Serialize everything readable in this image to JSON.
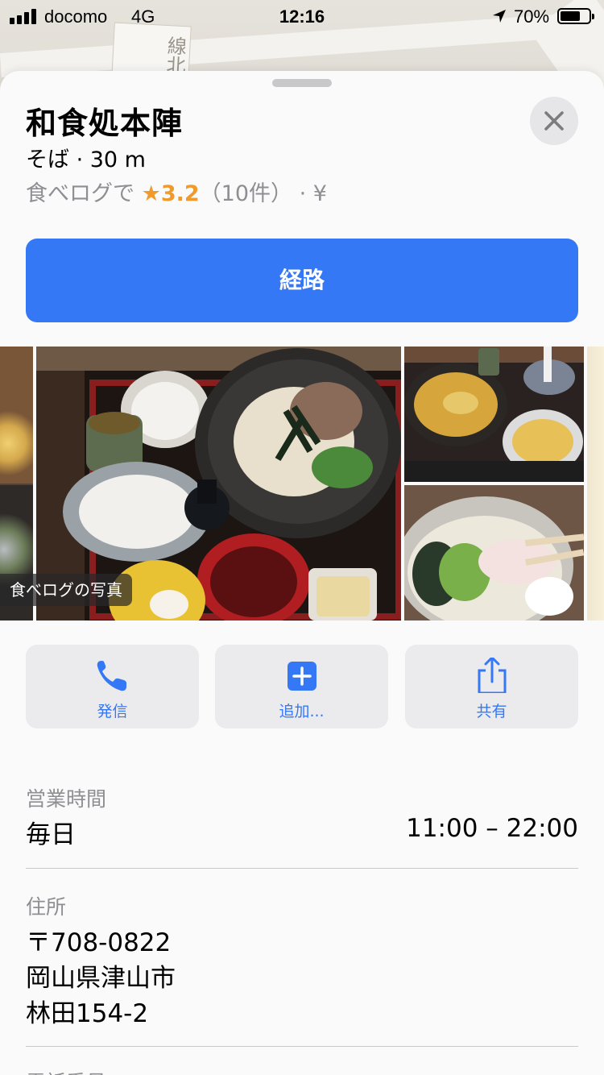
{
  "status_bar": {
    "carrier": "docomo",
    "network": "4G",
    "time": "12:16",
    "battery": "70%",
    "battery_level": 0.7
  },
  "map": {
    "road_label": "線北"
  },
  "place": {
    "name": "和食処本陣",
    "subtitle": "そば · 30 m",
    "rating_prefix": "食べログで",
    "rating_star": "★",
    "rating_score": "3.2",
    "rating_count": "（10件）",
    "price": "· ¥"
  },
  "route_button": "経路",
  "photos": {
    "badge": "食べログの写真"
  },
  "actions": [
    {
      "label": "発信",
      "icon": "phone-icon"
    },
    {
      "label": "追加...",
      "icon": "add-icon"
    },
    {
      "label": "共有",
      "icon": "share-icon"
    }
  ],
  "hours": {
    "label": "営業時間",
    "day": "毎日",
    "time": "11:00 – 22:00"
  },
  "address": {
    "label": "住所",
    "lines": [
      "〒708-0822",
      "岡山県津山市",
      "林田154-2"
    ]
  },
  "phone": {
    "label": "電話番号"
  },
  "colors": {
    "accent": "#3478f6",
    "star": "#f19a2c",
    "secondary_text": "#8e8e93"
  }
}
